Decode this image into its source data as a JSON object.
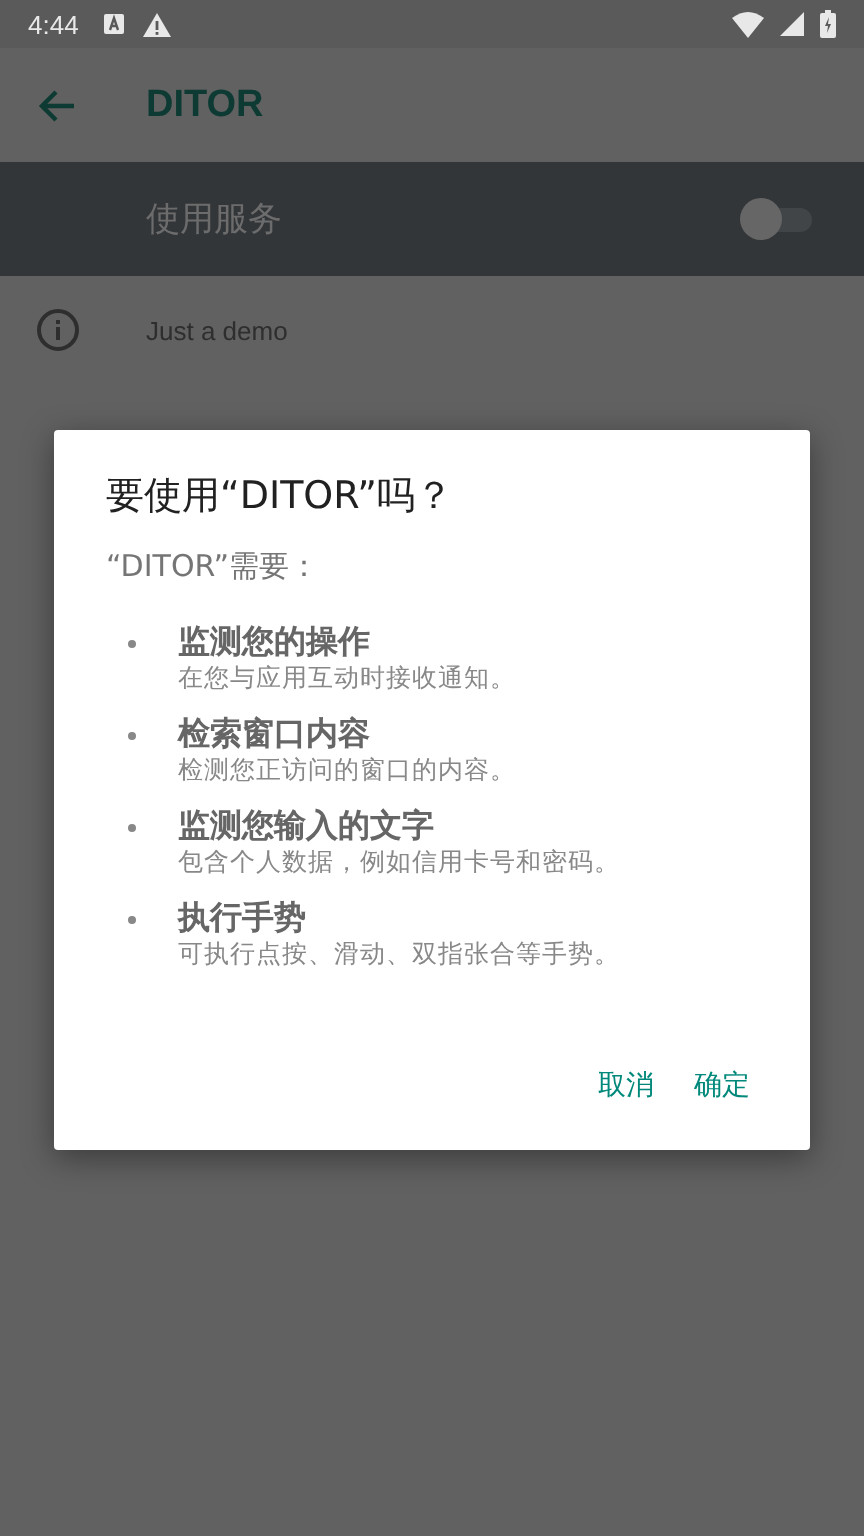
{
  "status_bar": {
    "time": "4:44"
  },
  "app_bar": {
    "title": "DITOR"
  },
  "service_row": {
    "label": "使用服务",
    "on": false
  },
  "info_row": {
    "text": "Just a demo"
  },
  "dialog": {
    "title": "要使用“DITOR”吗？",
    "subtitle": "“DITOR”需要：",
    "items": [
      {
        "title": "监测您的操作",
        "description": "在您与应用互动时接收通知。"
      },
      {
        "title": "检索窗口内容",
        "description": "检测您正访问的窗口的内容。"
      },
      {
        "title": "监测您输入的文字",
        "description": "包含个人数据，例如信用卡号和密码。"
      },
      {
        "title": "执行手势",
        "description": "可执行点按、滑动、双指张合等手势。"
      }
    ],
    "buttons": [
      "取消",
      "确定"
    ]
  }
}
